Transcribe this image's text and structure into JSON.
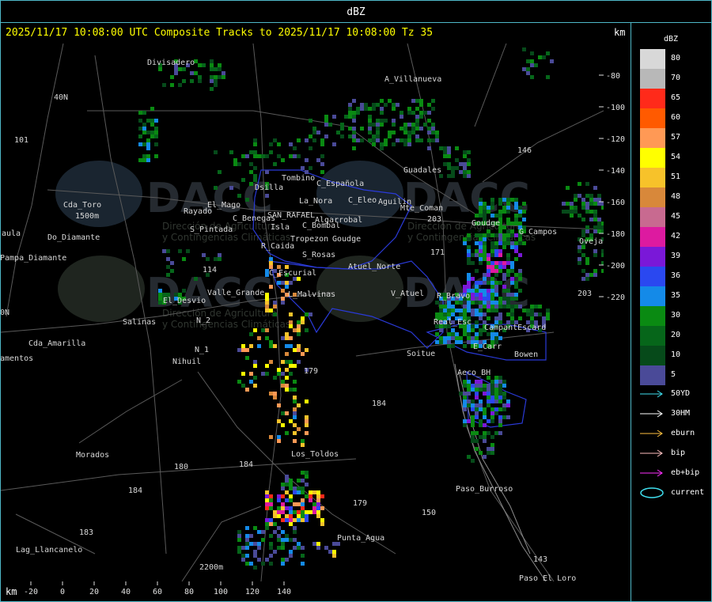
{
  "window": {
    "title": "dBZ"
  },
  "caption": "2025/11/17 10:08:00 UTC Composite Tracks to 2025/11/17 10:08:00 Tz 35",
  "axis_unit": "km",
  "y_ticks": [
    "-80",
    "-100",
    "-120",
    "-140",
    "-160",
    "-180",
    "-200",
    "-220"
  ],
  "x_ticks": [
    "-20",
    "0",
    "20",
    "40",
    "60",
    "80",
    "100",
    "120",
    "140"
  ],
  "legend": {
    "title": "dBZ",
    "scale": [
      {
        "label": "80",
        "color": "#d8d8d8"
      },
      {
        "label": "70",
        "color": "#b8b8b8"
      },
      {
        "label": "65",
        "color": "#ff2a1a"
      },
      {
        "label": "60",
        "color": "#ff5a00"
      },
      {
        "label": "57",
        "color": "#ff9955"
      },
      {
        "label": "54",
        "color": "#ffff00"
      },
      {
        "label": "51",
        "color": "#f7c22a"
      },
      {
        "label": "48",
        "color": "#d8883a"
      },
      {
        "label": "45",
        "color": "#c86a90"
      },
      {
        "label": "42",
        "color": "#dd1aa0"
      },
      {
        "label": "39",
        "color": "#7a18d8"
      },
      {
        "label": "36",
        "color": "#2a48f0"
      },
      {
        "label": "35",
        "color": "#148ae8"
      },
      {
        "label": "30",
        "color": "#0a8a12"
      },
      {
        "label": "20",
        "color": "#06661a"
      },
      {
        "label": "10",
        "color": "#064a1a"
      },
      {
        "label": "5",
        "color": "#4a4a98"
      }
    ],
    "tracks": [
      {
        "label": "50YD",
        "color": "#40e0f0"
      },
      {
        "label": "30HM",
        "color": "#ffffff"
      },
      {
        "label": "eburn",
        "color": "#ffc040"
      },
      {
        "label": "bip",
        "color": "#ffc0c0"
      },
      {
        "label": "eb+bip",
        "color": "#ff30ff"
      },
      {
        "label": "current",
        "color": "#40e0f0"
      }
    ]
  },
  "places": [
    "Divisadero",
    "A_Villanueva",
    "40N",
    "101",
    "Guadales",
    "Tombino",
    "Dsilla",
    "C_Española",
    "C_Eleo",
    "Aguilin",
    "La_Nora",
    "Rayado",
    "El_Mago",
    "Cda_Toro",
    "1500m",
    "aula",
    "Do_Diamante",
    "C_Benegas",
    "SAN_RAFAEL",
    "Algarrobal",
    "C_Bombal",
    "S_Pintada",
    "Isla",
    "Tropezon",
    "Goudge",
    "146",
    "203",
    "Goudge",
    "G_Campos",
    "Ovejas",
    "Pampa_Diamante",
    "R_Caida",
    "S_Rosas",
    "Atuel_Norte",
    "Mte_Coman",
    "171",
    "114",
    "C_Escurial",
    "El_Desvio",
    "Valle_Grande",
    "L_Malvinas",
    "V_Atuel",
    "R_Bravo",
    "0N",
    "Salinas",
    "N_2",
    "Cda_Amarilla",
    "N_1",
    "Nihuil",
    "amentos",
    "Soitue",
    "E_Carr",
    "Real_Esc",
    "CampantEscard",
    "Bowen",
    "Aeco_BH",
    "179",
    "184",
    "Los_Toldos",
    "Morados",
    "180",
    "184",
    "Paso_Burroso",
    "179",
    "150",
    "184",
    "Lag_Llancanelo",
    "183",
    "Punta_Agua",
    "2200m",
    "143",
    "Paso_El_Loro",
    "203"
  ],
  "watermark": {
    "logo": "DACC",
    "subtitle_1": "Dirección de Agricultura",
    "subtitle_2": "y Contingencias Climáticas"
  }
}
